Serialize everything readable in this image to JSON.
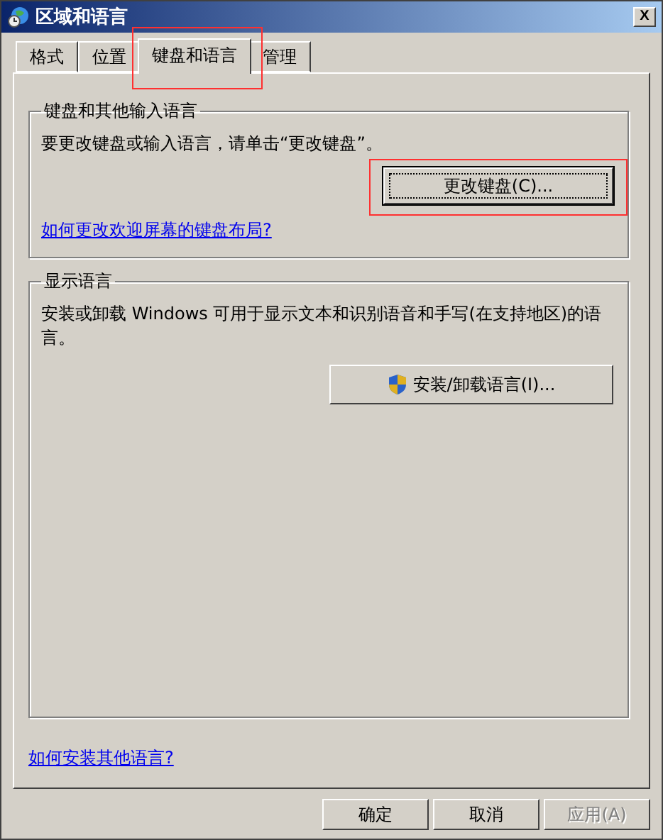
{
  "window": {
    "title": "区域和语言",
    "close": "X"
  },
  "tabs": [
    {
      "label": "格式",
      "selected": false,
      "highlighted": false
    },
    {
      "label": "位置",
      "selected": false,
      "highlighted": false
    },
    {
      "label": "键盘和语言",
      "selected": true,
      "highlighted": true
    },
    {
      "label": "管理",
      "selected": false,
      "highlighted": false
    }
  ],
  "keyboard_group": {
    "title": "键盘和其他输入语言",
    "text": "要更改键盘或输入语言，请单击“更改键盘”。",
    "button": {
      "label": "更改键盘(C)...",
      "focused": true,
      "highlighted": true
    },
    "link": "如何更改欢迎屏幕的键盘布局?"
  },
  "display_group": {
    "title": "显示语言",
    "text": "安装或卸载 Windows 可用于显示文本和识别语音和手写(在支持地区)的语言。",
    "button": {
      "label": "安装/卸载语言(I)...",
      "shield": true
    }
  },
  "bottom_link": "如何安装其他语言?",
  "buttons": [
    {
      "label": "确定",
      "disabled": false
    },
    {
      "label": "取消",
      "disabled": false
    },
    {
      "label": "应用(A)",
      "disabled": true
    }
  ]
}
